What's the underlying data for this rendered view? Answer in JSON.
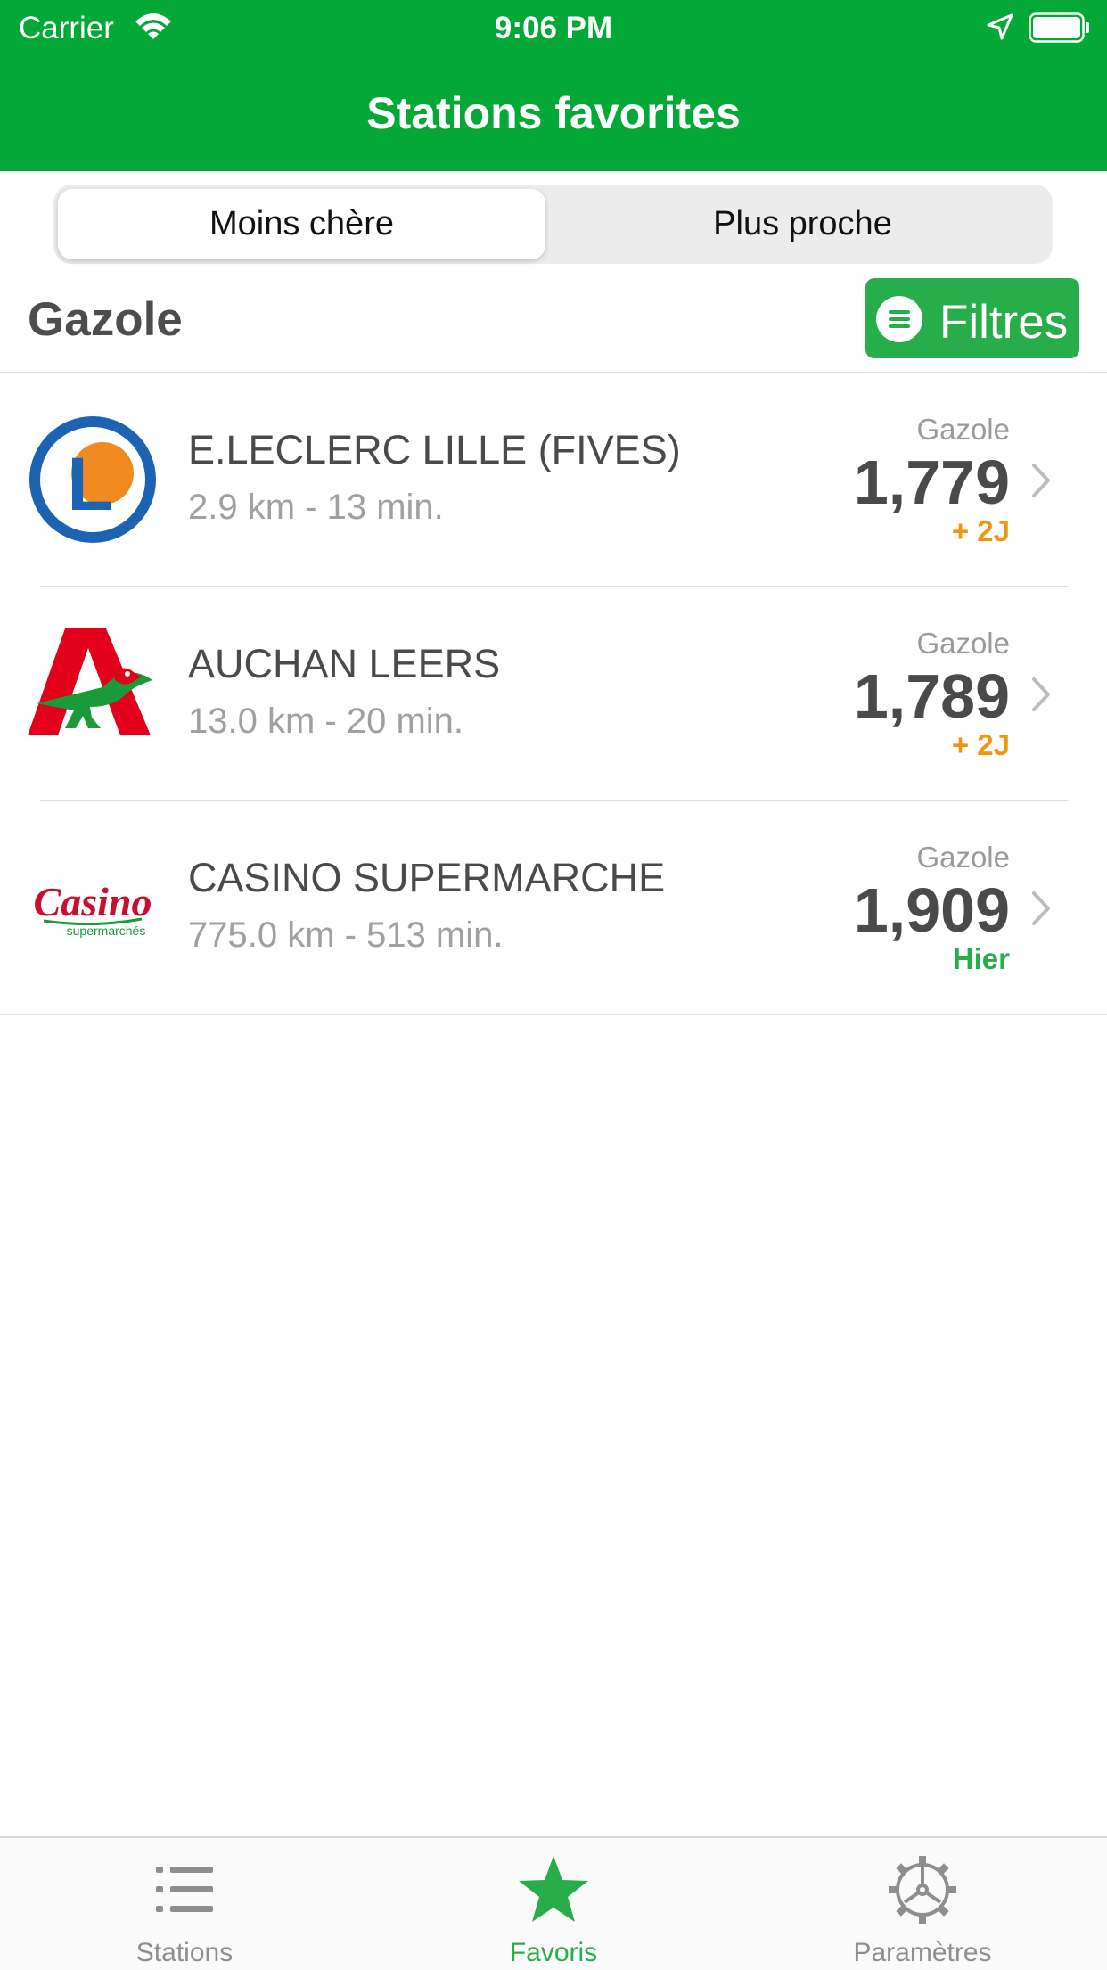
{
  "status_bar": {
    "carrier": "Carrier",
    "time": "9:06 PM"
  },
  "nav": {
    "title": "Stations favorites"
  },
  "segments": {
    "cheapest": "Moins chère",
    "closest": "Plus proche"
  },
  "fuel": {
    "label": "Gazole",
    "filter_label": "Filtres"
  },
  "stations": [
    {
      "name": "E.LECLERC LILLE (FIVES)",
      "distance": "2.9 km - 13 min.",
      "fuel": "Gazole",
      "price": "1,779",
      "age": "+ 2J",
      "age_color": "#f0950f",
      "logo": "leclerc-logo"
    },
    {
      "name": "AUCHAN LEERS",
      "distance": "13.0 km - 20 min.",
      "fuel": "Gazole",
      "price": "1,789",
      "age": "+ 2J",
      "age_color": "#f0950f",
      "logo": "auchan-logo"
    },
    {
      "name": "CASINO SUPERMARCHE",
      "distance": "775.0 km - 513 min.",
      "fuel": "Gazole",
      "price": "1,909",
      "age": "Hier",
      "age_color": "#27ae4b",
      "logo": "casino-logo"
    }
  ],
  "tabs": [
    {
      "label": "Stations",
      "icon": "list-icon",
      "active": false
    },
    {
      "label": "Favoris",
      "icon": "star-icon",
      "active": true
    },
    {
      "label": "Paramètres",
      "icon": "gear-icon",
      "active": false
    }
  ],
  "colors": {
    "brand_green": "#03a837",
    "button_green": "#27ae4b",
    "warning_orange": "#f0950f"
  },
  "logos": {
    "leclerc_letter": "L",
    "casino_wordmark": "Casino",
    "casino_tagline": "supermarchés"
  }
}
